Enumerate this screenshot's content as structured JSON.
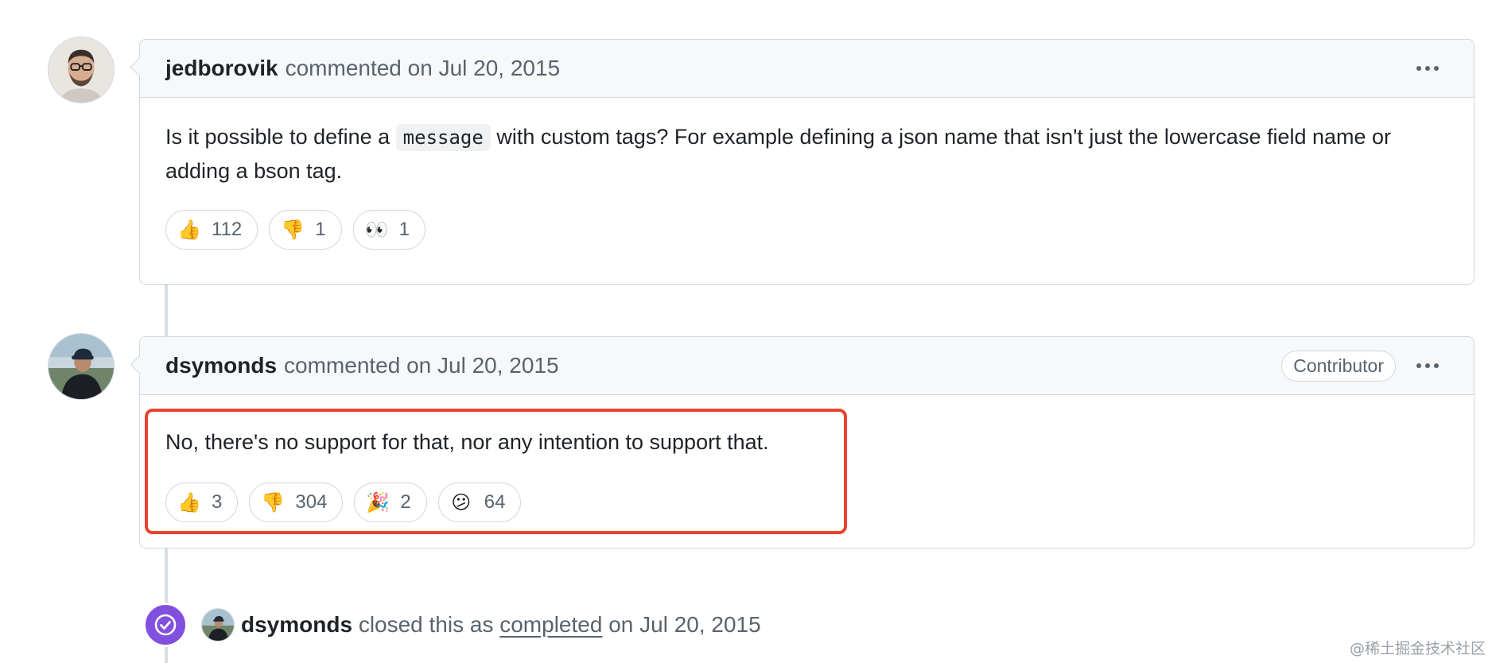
{
  "comments": [
    {
      "author": "jedborovik",
      "meta": "commented on Jul 20, 2015",
      "body_before_code": "Is it possible to define a ",
      "code": "message",
      "body_after_code": " with custom tags? For example defining a json name that isn't just the lowercase field name or adding a bson tag.",
      "reactions": [
        {
          "emoji": "👍",
          "icon": "thumbs-up-icon",
          "count": "112"
        },
        {
          "emoji": "👎",
          "icon": "thumbs-down-icon",
          "count": "1"
        },
        {
          "emoji": "👀",
          "icon": "eyes-icon",
          "count": "1"
        }
      ]
    },
    {
      "author": "dsymonds",
      "meta": "commented on Jul 20, 2015",
      "badge": "Contributor",
      "body": "No, there's no support for that, nor any intention to support that.",
      "reactions": [
        {
          "emoji": "👍",
          "icon": "thumbs-up-icon",
          "count": "3"
        },
        {
          "emoji": "👎",
          "icon": "thumbs-down-icon",
          "count": "304"
        },
        {
          "emoji": "🎉",
          "icon": "party-popper-icon",
          "count": "2"
        },
        {
          "emoji": "😕",
          "icon": "confused-face-icon",
          "count": "64"
        }
      ]
    }
  ],
  "event": {
    "author": "dsymonds",
    "text_before_link": "closed this as",
    "link": "completed",
    "text_after_link": "on Jul 20, 2015"
  },
  "watermark": "@稀土掘金技术社区",
  "colors": {
    "accent_closed": "#8250df",
    "highlight": "#e5452e"
  }
}
